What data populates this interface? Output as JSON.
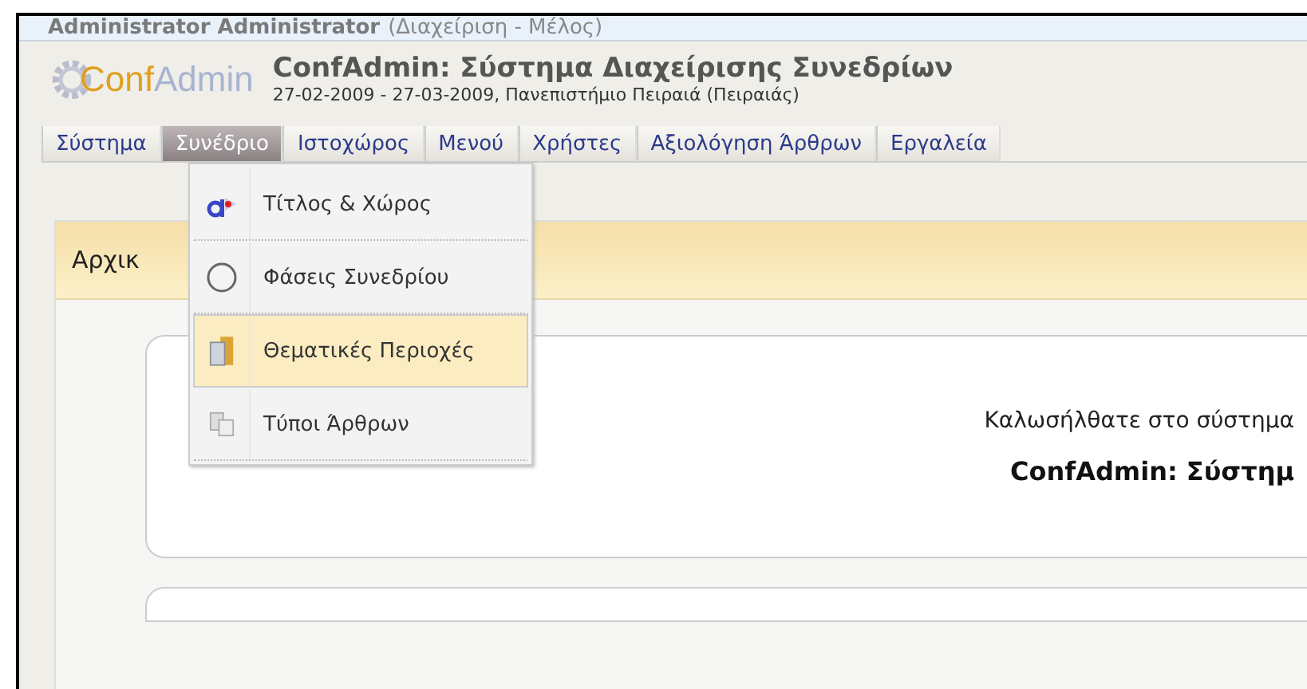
{
  "user_bar": {
    "name": "Administrator Administrator",
    "role": "(Διαχείριση - Μέλος)"
  },
  "header": {
    "logo_prefix": "Conf",
    "logo_suffix": "Admin",
    "title": "ConfAdmin: Σύστημα Διαχείρισης Συνεδρίων",
    "subtitle": "27-02-2009 - 27-03-2009, Πανεπιστήμιο Πειραιά (Πειραιάς)"
  },
  "tabs": [
    {
      "label": "Σύστημα",
      "selected": false
    },
    {
      "label": "Συνέδριο",
      "selected": true
    },
    {
      "label": "Ιστοχώρος",
      "selected": false
    },
    {
      "label": "Μενού",
      "selected": false
    },
    {
      "label": "Χρήστες",
      "selected": false
    },
    {
      "label": "Αξιολόγηση Άρθρων",
      "selected": false
    },
    {
      "label": "Εργαλεία",
      "selected": false
    }
  ],
  "dropdown": [
    {
      "label": "Τίτλος & Χώρος",
      "kind": "text",
      "selected": false
    },
    {
      "label": "Φάσεις Συνεδρίου",
      "kind": "clock",
      "selected": false
    },
    {
      "label": "Θεματικές Περιοχές",
      "kind": "folder",
      "selected": true
    },
    {
      "label": "Τύποι Άρθρων",
      "kind": "pages",
      "selected": false
    }
  ],
  "panel": {
    "title": "Αρχικ",
    "welcome": "Καλωσήλθατε στο σύστημα",
    "system_name": "ConfAdmin: Σύστημ"
  }
}
